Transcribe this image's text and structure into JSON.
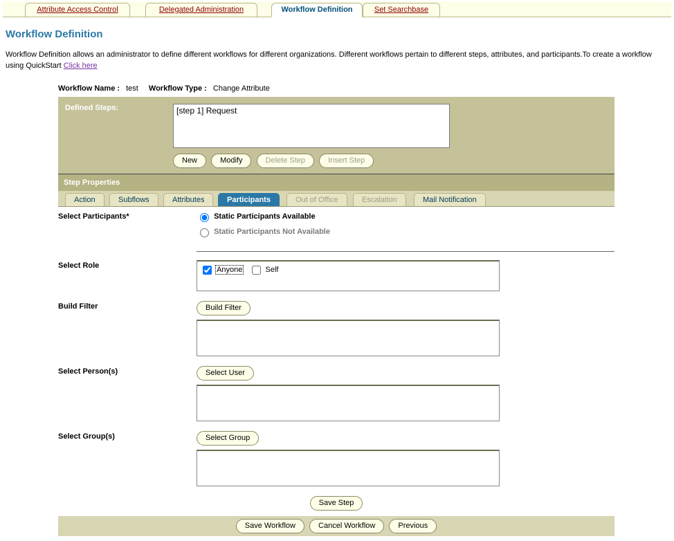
{
  "topTabs": {
    "t0": "Attribute Access Control",
    "t1": "Delegated Administration",
    "t2": "Workflow Definition",
    "t3": "Set Searchbase"
  },
  "page": {
    "title": "Workflow Definition",
    "intro_before": "Workflow Definition allows an administrator to define different workflows for different organizations. Different workflows pertain to different steps, attributes, and participants.To create a workflow using QuickStart ",
    "intro_link": "Click here"
  },
  "meta": {
    "name_label": "Workflow Name :",
    "name_value": "test",
    "type_label": "Workflow Type :",
    "type_value": "Change Attribute"
  },
  "stepsPanel": {
    "label": "Defined Steps:",
    "item0": "[step 1] Request",
    "btn_new": "New",
    "btn_modify": "Modify",
    "btn_delete": "Delete Step",
    "btn_insert": "Insert Step"
  },
  "stepProps": {
    "header": "Step Properties",
    "tabs": {
      "action": "Action",
      "subflows": "Subflows",
      "attributes": "Attributes",
      "participants": "Participants",
      "ooo": "Out of Office",
      "escalation": "Escalation",
      "mail": "Mail Notification"
    }
  },
  "participants": {
    "label_select": "Select Participants*",
    "radio_avail": "Static Participants Available",
    "radio_not": "Static Participants Not Available",
    "label_role": "Select Role",
    "role_anyone": "Anyone",
    "role_self": "Self",
    "label_filter": "Build Filter",
    "btn_filter": "Build Filter",
    "label_person": "Select Person(s)",
    "btn_person": "Select User",
    "label_group": "Select Group(s)",
    "btn_group": "Select Group",
    "btn_save_step": "Save Step"
  },
  "bottom": {
    "save": "Save Workflow",
    "cancel": "Cancel Workflow",
    "prev": "Previous"
  }
}
